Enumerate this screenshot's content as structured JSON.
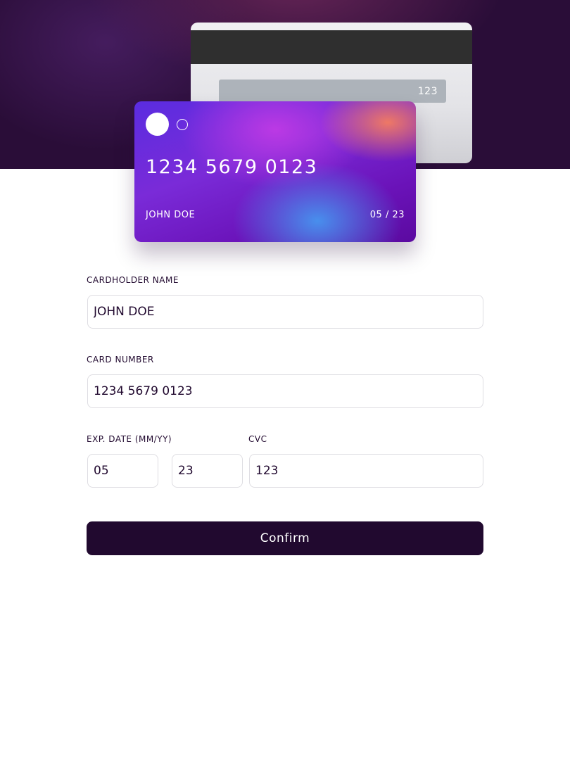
{
  "card": {
    "number": "1234 5679 0123",
    "holder": "JOHN DOE",
    "expiry": "05 / 23",
    "cvc": "123"
  },
  "form": {
    "cardholder_label": "CARDHOLDER NAME",
    "cardholder_value": "JOHN DOE",
    "number_label": "CARD NUMBER",
    "number_value": "1234 5679 0123",
    "exp_label": "EXP. DATE (MM/YY)",
    "exp_month_value": "05",
    "exp_year_value": "23",
    "cvc_label": "CVC",
    "cvc_value": "123",
    "confirm_label": "Confirm"
  },
  "colors": {
    "dark_purple": "#21092f",
    "field_border": "#dedde2"
  }
}
